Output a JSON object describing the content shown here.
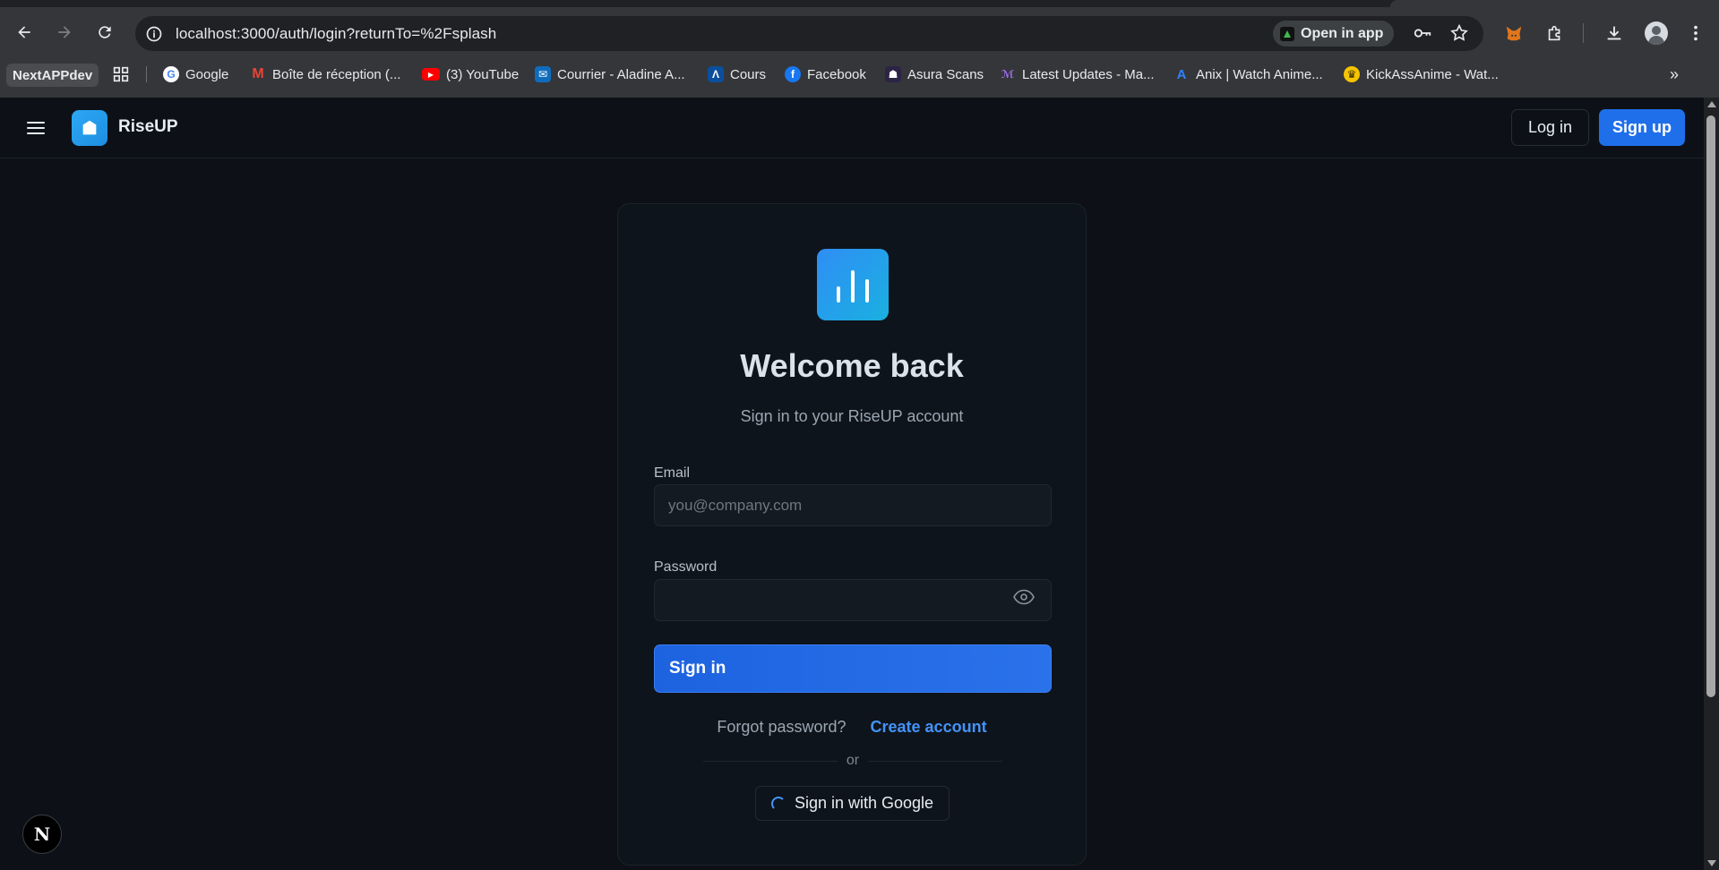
{
  "browser": {
    "url": "localhost:3000/auth/login?returnTo=%2Fsplash",
    "open_in_app": "Open in app",
    "bookmark_folder": "NextAPPdev",
    "bookmarks": [
      {
        "label": "Google",
        "icon": "google-icon",
        "color": "#4285f4"
      },
      {
        "label": "Boîte de réception (...",
        "icon": "gmail-icon",
        "color": "#ea4335"
      },
      {
        "label": "(3) YouTube",
        "icon": "youtube-icon",
        "color": "#ff0000"
      },
      {
        "label": "Courrier - Aladine A...",
        "icon": "outlook-icon",
        "color": "#0f6cbd"
      },
      {
        "label": "Cours",
        "icon": "cours-icon",
        "color": "#1a7f37"
      },
      {
        "label": "Facebook",
        "icon": "facebook-icon",
        "color": "#1877f2"
      },
      {
        "label": "Asura Scans",
        "icon": "asura-icon",
        "color": "#6e40c9"
      },
      {
        "label": "Latest Updates - Ma...",
        "icon": "manga-icon",
        "color": "#8957e5"
      },
      {
        "label": "Anix | Watch Anime...",
        "icon": "anix-icon",
        "color": "#2f81f7"
      },
      {
        "label": "KickAssAnime - Wat...",
        "icon": "kickass-icon",
        "color": "#f5c400"
      }
    ]
  },
  "header": {
    "brand": "RiseUP",
    "login": "Log in",
    "signup": "Sign up"
  },
  "login": {
    "title": "Welcome back",
    "subtitle": "Sign in to your RiseUP account",
    "email_label": "Email",
    "email_placeholder": "you@company.com",
    "email_value": "",
    "password_label": "Password",
    "password_value": "",
    "signin": "Sign in",
    "forgot": "Forgot password?",
    "create": "Create account",
    "or": "or",
    "google": "Sign in with Google"
  },
  "dev_badge": "N"
}
